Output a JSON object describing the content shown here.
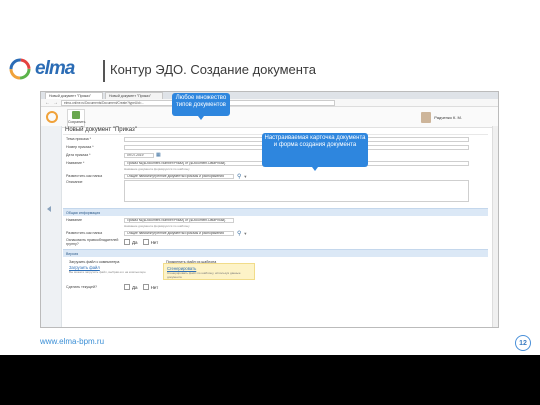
{
  "slide": {
    "logo_text": "elma",
    "title": "Контур ЭДО. Создание документа",
    "footer_url": "www.elma-bpm.ru",
    "page_number": "12"
  },
  "browser": {
    "tabs": [
      "Новый документ \"Приказ\"",
      "Новый документ \"Приказ\""
    ],
    "address": "elma-online.ru/Documents/Document/Create?typeUid=..."
  },
  "toolbar": {
    "save_label": "Сохранить",
    "user_name": "Радченко К. М."
  },
  "form": {
    "title": "Новый документ \"Приказ\"",
    "fields": [
      {
        "label": "Тема приказа *",
        "value": ""
      },
      {
        "label": "Номер приказа *",
        "value": ""
      },
      {
        "label": "Дата приказа *",
        "value": "09.07.2019"
      },
      {
        "label": "Название *",
        "value": "Приказ №{$Document.Number/Prikaz} от {$Document.DataPrikaz}"
      },
      {
        "label": "Разместить как папка",
        "value": "Общие папки/Внутренние документы/Приказы и распоряжения"
      },
      {
        "label": "Описание",
        "value": ""
      }
    ],
    "hint_1": "Название документа формируется по шаблону",
    "section_general": "Общая информация",
    "name_label": "Название",
    "name_value": "Приказ №{$Document.Number/Prikaz} от {$Document.DataPrikaz}",
    "hint_2": "Название документа формируется по шаблону",
    "folder_label": "Разместить как папка",
    "folder_value": "Общие папки/Внутренние документы/Приказы и распоряжения",
    "obligatory_label": "Ознакомить правообладателей группу?",
    "yes_label": "Да",
    "no_label": "Нет",
    "section_version": "Версия",
    "upload_left_title": "Загрузить файл с компьютера",
    "upload_left_link": "Загрузить файл",
    "upload_left_hint": "Вы можете загрузить файл, выбрав его на компьютере",
    "upload_right_title": "Прикрепить файл из шаблона",
    "upload_right_link": "Сгенерировать",
    "upload_right_hint": "Сгенерировать файл по шаблону, используя данные документа",
    "signed_label": "Сделать текущей?"
  },
  "callouts": {
    "top": "Любое множество типов документов",
    "middle": "Настраиваемая карточка документа и форма создания документа"
  },
  "colors": {
    "accent": "#2e86de",
    "brand": "#2b6cb5",
    "logo_ring_1": "#f0a23a",
    "logo_ring_2": "#5bb34a"
  }
}
